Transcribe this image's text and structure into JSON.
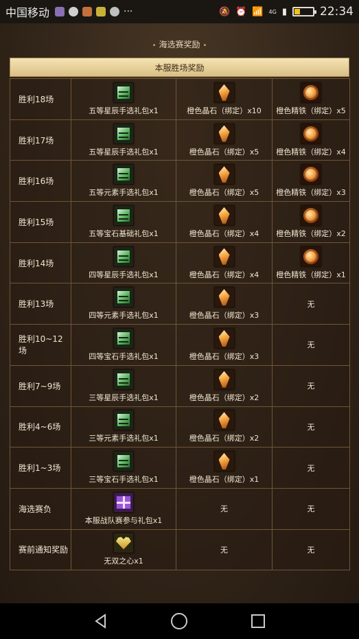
{
  "status_bar": {
    "carrier": "中国移动",
    "network": "4G",
    "time": "22:34",
    "battery_level": 0.3,
    "battery_color": "#f4c21b"
  },
  "page": {
    "title": "海选赛奖励",
    "section_header": "本服胜场奖励",
    "header_color": "#e6cf97"
  },
  "rows": [
    {
      "label": "胜利18场",
      "r1": {
        "icon": "pack-icon",
        "text": "五等星辰手选礼包x1"
      },
      "r2": {
        "icon": "crystal-icon",
        "text": "橙色晶石（绑定）x10"
      },
      "r3": {
        "icon": "iron-icon",
        "text": "橙色精铁（绑定）x5"
      }
    },
    {
      "label": "胜利17场",
      "r1": {
        "icon": "pack-icon",
        "text": "五等星辰手选礼包x1"
      },
      "r2": {
        "icon": "crystal-icon",
        "text": "橙色晶石（绑定）x5"
      },
      "r3": {
        "icon": "iron-icon",
        "text": "橙色精铁（绑定）x4"
      }
    },
    {
      "label": "胜利16场",
      "r1": {
        "icon": "pack-icon",
        "text": "五等元素手选礼包x1"
      },
      "r2": {
        "icon": "crystal-icon",
        "text": "橙色晶石（绑定）x5"
      },
      "r3": {
        "icon": "iron-icon",
        "text": "橙色精铁（绑定）x3"
      }
    },
    {
      "label": "胜利15场",
      "r1": {
        "icon": "pack-icon",
        "text": "五等宝石基础礼包x1"
      },
      "r2": {
        "icon": "crystal-icon",
        "text": "橙色晶石（绑定）x4"
      },
      "r3": {
        "icon": "iron-icon",
        "text": "橙色精铁（绑定）x2"
      }
    },
    {
      "label": "胜利14场",
      "r1": {
        "icon": "pack-icon",
        "text": "四等星辰手选礼包x1"
      },
      "r2": {
        "icon": "crystal-icon",
        "text": "橙色晶石（绑定）x4"
      },
      "r3": {
        "icon": "iron-icon",
        "text": "橙色精铁（绑定）x1"
      }
    },
    {
      "label": "胜利13场",
      "r1": {
        "icon": "pack-icon",
        "text": "四等元素手选礼包x1"
      },
      "r2": {
        "icon": "crystal-icon",
        "text": "橙色晶石（绑定）x3"
      },
      "r3": {
        "icon": "",
        "text": "无"
      }
    },
    {
      "label": "胜利10~12场",
      "r1": {
        "icon": "pack-icon",
        "text": "四等宝石手选礼包x1"
      },
      "r2": {
        "icon": "crystal-icon",
        "text": "橙色晶石（绑定）x3"
      },
      "r3": {
        "icon": "",
        "text": "无"
      }
    },
    {
      "label": "胜利7~9场",
      "r1": {
        "icon": "pack-icon",
        "text": "三等星辰手选礼包x1"
      },
      "r2": {
        "icon": "crystal-icon",
        "text": "橙色晶石（绑定）x2"
      },
      "r3": {
        "icon": "",
        "text": "无"
      }
    },
    {
      "label": "胜利4~6场",
      "r1": {
        "icon": "pack-icon",
        "text": "三等元素手选礼包x1"
      },
      "r2": {
        "icon": "crystal-icon",
        "text": "橙色晶石（绑定）x2"
      },
      "r3": {
        "icon": "",
        "text": "无"
      }
    },
    {
      "label": "胜利1~3场",
      "r1": {
        "icon": "pack-icon",
        "text": "三等宝石手选礼包x1"
      },
      "r2": {
        "icon": "crystal-icon",
        "text": "橙色晶石（绑定）x1"
      },
      "r3": {
        "icon": "",
        "text": "无"
      }
    },
    {
      "label": "海选赛负",
      "r1": {
        "icon": "gift-icon",
        "text": "本服战队赛参与礼包x1"
      },
      "r2": {
        "icon": "",
        "text": "无"
      },
      "r3": {
        "icon": "",
        "text": "无"
      }
    },
    {
      "label": "赛前通知奖励",
      "r1": {
        "icon": "heart-icon",
        "text": "无双之心x1"
      },
      "r2": {
        "icon": "",
        "text": "无"
      },
      "r3": {
        "icon": "",
        "text": "无"
      }
    }
  ]
}
